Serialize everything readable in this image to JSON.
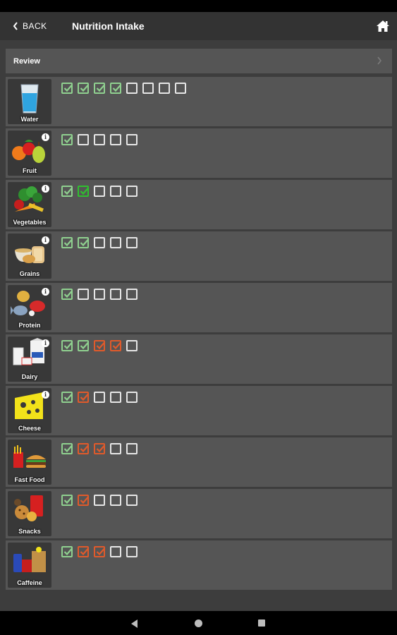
{
  "header": {
    "back_label": "BACK",
    "title": "Nutrition Intake"
  },
  "review": {
    "label": "Review"
  },
  "colors": {
    "green_check": "#8fd08f",
    "dark_green_check": "#2fbf2f",
    "orange_check": "#e05a2b",
    "empty_box": "#e6e6e6"
  },
  "categories": [
    {
      "id": "water",
      "label": "Water",
      "icon": "water-glass-icon",
      "info": false,
      "boxes": [
        "green",
        "green",
        "green",
        "green",
        "empty",
        "empty",
        "empty",
        "empty"
      ]
    },
    {
      "id": "fruit",
      "label": "Fruit",
      "icon": "fruit-icon",
      "info": true,
      "boxes": [
        "green",
        "empty",
        "empty",
        "empty",
        "empty"
      ]
    },
    {
      "id": "vegetables",
      "label": "Vegetables",
      "icon": "vegetables-icon",
      "info": true,
      "boxes": [
        "green",
        "dgreen",
        "empty",
        "empty",
        "empty"
      ]
    },
    {
      "id": "grains",
      "label": "Grains",
      "icon": "grains-icon",
      "info": true,
      "boxes": [
        "green",
        "green",
        "empty",
        "empty",
        "empty"
      ]
    },
    {
      "id": "protein",
      "label": "Protein",
      "icon": "protein-icon",
      "info": true,
      "boxes": [
        "green",
        "empty",
        "empty",
        "empty",
        "empty"
      ]
    },
    {
      "id": "dairy",
      "label": "Dairy",
      "icon": "dairy-icon",
      "info": true,
      "boxes": [
        "green",
        "green",
        "orange",
        "orange",
        "empty"
      ]
    },
    {
      "id": "cheese",
      "label": "Cheese",
      "icon": "cheese-icon",
      "info": true,
      "boxes": [
        "green",
        "orange",
        "empty",
        "empty",
        "empty"
      ]
    },
    {
      "id": "fast-food",
      "label": "Fast Food",
      "icon": "fast-food-icon",
      "info": false,
      "boxes": [
        "green",
        "orange",
        "orange",
        "empty",
        "empty"
      ]
    },
    {
      "id": "snacks",
      "label": "Snacks",
      "icon": "snacks-icon",
      "info": false,
      "boxes": [
        "green",
        "orange",
        "empty",
        "empty",
        "empty"
      ]
    },
    {
      "id": "caffeine",
      "label": "Caffeine",
      "icon": "caffeine-icon",
      "info": false,
      "boxes": [
        "green",
        "orange",
        "orange",
        "empty",
        "empty"
      ]
    }
  ]
}
